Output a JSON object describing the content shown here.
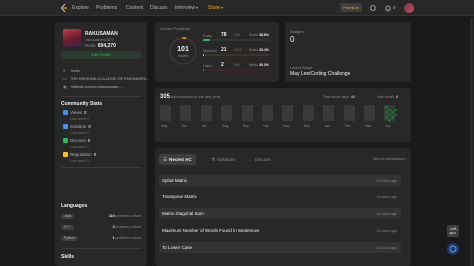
{
  "nav": {
    "items": [
      "Explore",
      "Problems",
      "Contest",
      "Discuss",
      "Interview"
    ],
    "store": "Store",
    "premium": "Premium",
    "notifications": "0"
  },
  "profile": {
    "name": "RAKUSAMAN",
    "handle": "rakusaman2307",
    "rank_label": "Rank",
    "rank_value": "694,270",
    "edit_button": "Edit Profile",
    "location": "India",
    "school": "SRI KRISHNA COLLEGE OF ENGINEERI...",
    "linkedin": "linkedin.com/in/rakusaman-..."
  },
  "community": {
    "title": "Community Stats",
    "items": [
      {
        "name": "Views",
        "value": "0",
        "sub": "Last week 0",
        "color": "#4a90e2"
      },
      {
        "name": "Solution",
        "value": "0",
        "sub": "Last week 0",
        "color": "#4a90e2"
      },
      {
        "name": "Discuss",
        "value": "0",
        "sub": "Last week 0",
        "color": "#2cbb5d"
      },
      {
        "name": "Reputation",
        "value": "0",
        "sub": "Last week 0",
        "color": "#ffc01e"
      }
    ]
  },
  "languages": {
    "title": "Languages",
    "items": [
      {
        "name": "Java",
        "count": "110",
        "label": "problems solved"
      },
      {
        "name": "C++",
        "count": "3",
        "label": "problems solved"
      },
      {
        "name": "Python",
        "count": "1",
        "label": "problems solved"
      }
    ]
  },
  "skills": {
    "title": "Skills"
  },
  "solved": {
    "title": "Solved Problems",
    "total": "101",
    "total_label": "Solved",
    "difficulties": [
      {
        "name": "Easy",
        "solved": "78",
        "total": "/754",
        "beats_label": "Beats",
        "beats": "38.8%",
        "fraction": 0.103,
        "color": "#2cbb5d",
        "track": "#2a3a2e"
      },
      {
        "name": "Medium",
        "solved": "21",
        "total": "/1596",
        "beats_label": "Beats",
        "beats": "33.4%",
        "fraction": 0.013,
        "color": "#ffc01e",
        "track": "#3e3623"
      },
      {
        "name": "Hard",
        "solved": "2",
        "total": "/666",
        "beats_label": "Beats",
        "beats": "30.3%",
        "fraction": 0.003,
        "color": "#ef4743",
        "track": "#3e2525"
      }
    ]
  },
  "badges": {
    "label": "Badges",
    "count": "0",
    "recent_label": "Locked Badge",
    "recent_name": "May LeetCoding Challenge"
  },
  "calendar": {
    "count": "305",
    "desc": "submissions in the last year",
    "active_label": "Total active days:",
    "active_value": "44",
    "streak_label": "Max streak:",
    "streak_value": "6",
    "months": [
      "May",
      "Jun",
      "Jul",
      "Aug",
      "Sep",
      "Oct",
      "Nov",
      "Dec",
      "Jan",
      "Feb",
      "Mar",
      "Apr"
    ]
  },
  "tabs": {
    "items": [
      "Recent AC",
      "Solutions",
      "Discuss"
    ],
    "view_all": "View all submissions"
  },
  "recent_ac": [
    {
      "title": "Spiral Matrix",
      "time": "10 hours ago"
    },
    {
      "title": "Transpose Matrix",
      "time": "11 hours ago"
    },
    {
      "title": "Matrix Diagonal Sum",
      "time": "11 hours ago"
    },
    {
      "title": "Maximum Number of Words Found in Sentences",
      "time": "12 hours ago"
    },
    {
      "title": "To Lower Case",
      "time": "12 hours ago"
    }
  ]
}
